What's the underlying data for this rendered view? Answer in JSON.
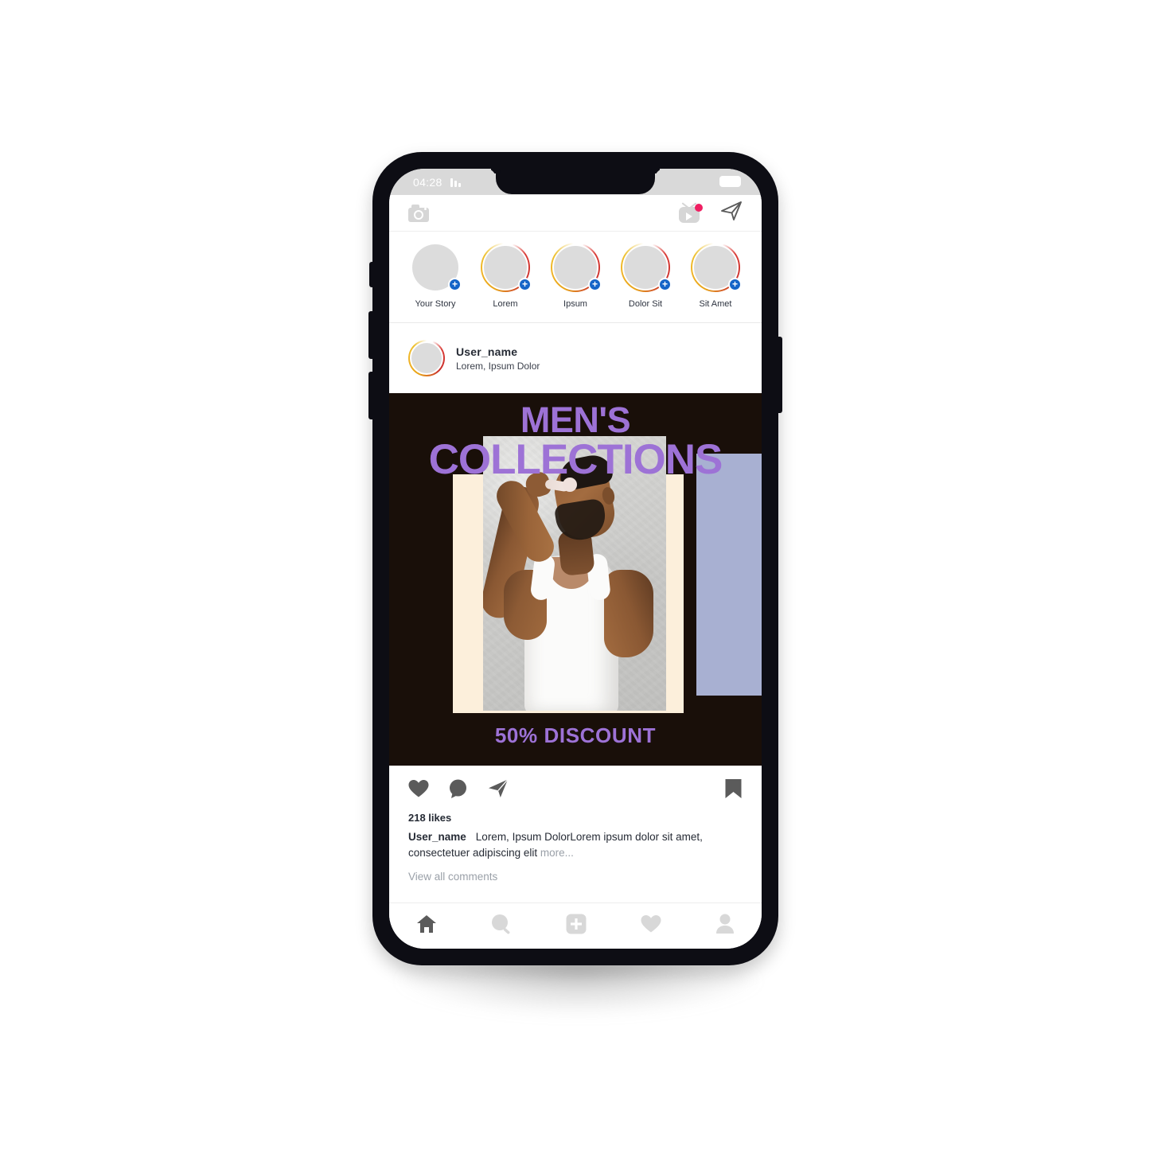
{
  "status_bar": {
    "time": "04:28",
    "signal_icon": "signal-bars-icon",
    "battery_icon": "battery-icon"
  },
  "top_nav": {
    "camera_icon": "camera-icon",
    "igtv_icon": "igtv-icon",
    "igtv_badge": "notification-dot",
    "direct_icon": "direct-message-icon"
  },
  "stories": [
    {
      "label": "Your Story",
      "has_ring": false,
      "has_plus": true
    },
    {
      "label": "Lorem",
      "has_ring": true,
      "has_plus": true
    },
    {
      "label": "Ipsum",
      "has_ring": true,
      "has_plus": true
    },
    {
      "label": "Dolor Sit",
      "has_ring": true,
      "has_plus": true
    },
    {
      "label": "Sit Amet",
      "has_ring": true,
      "has_plus": true
    }
  ],
  "post": {
    "username": "User_name",
    "location": "Lorem, Ipsum Dolor",
    "creative": {
      "title_line1": "MEN'S",
      "title_line2": "COLLECTIONS",
      "discount": "50% DISCOUNT",
      "photo_alt": "man-in-white-tank-top-applying-skincare-tool"
    },
    "actions": {
      "like_icon": "heart-icon",
      "comment_icon": "comment-icon",
      "share_icon": "share-icon",
      "save_icon": "bookmark-icon"
    },
    "likes": "218 likes",
    "caption_user": "User_name",
    "caption_text": "Lorem, Ipsum DolorLorem ipsum dolor sit amet, consectetuer adipiscing elit",
    "caption_more": "more...",
    "view_comments": "View all comments"
  },
  "tab_bar": [
    {
      "name": "home",
      "icon": "home-icon",
      "active": true
    },
    {
      "name": "search",
      "icon": "search-icon",
      "active": false
    },
    {
      "name": "add",
      "icon": "add-post-icon",
      "active": false
    },
    {
      "name": "activity",
      "icon": "heart-icon",
      "active": false
    },
    {
      "name": "profile",
      "icon": "profile-icon",
      "active": false
    }
  ],
  "colors": {
    "accent_purple": "#9d72d6",
    "creative_bg": "#190f09",
    "cream_panel": "#fcefdb",
    "lavender_panel": "#a8b0d2",
    "story_plus_blue": "#1565c8",
    "notification_pink": "#ef1f62"
  }
}
